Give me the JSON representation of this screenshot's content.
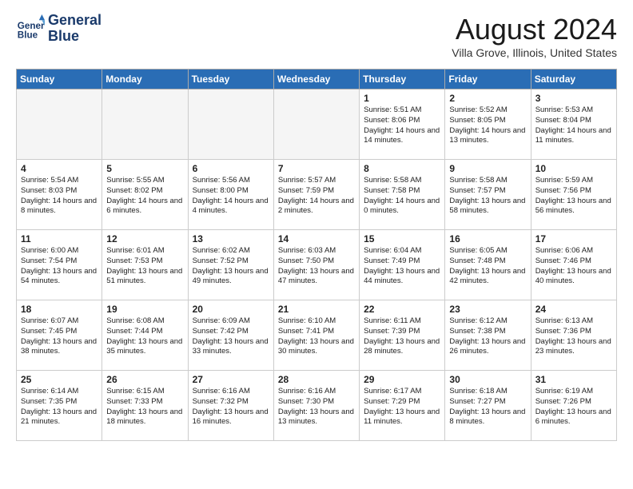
{
  "logo": {
    "line1": "General",
    "line2": "Blue"
  },
  "title": "August 2024",
  "subtitle": "Villa Grove, Illinois, United States",
  "days_of_week": [
    "Sunday",
    "Monday",
    "Tuesday",
    "Wednesday",
    "Thursday",
    "Friday",
    "Saturday"
  ],
  "weeks": [
    [
      {
        "day": "",
        "empty": true
      },
      {
        "day": "",
        "empty": true
      },
      {
        "day": "",
        "empty": true
      },
      {
        "day": "",
        "empty": true
      },
      {
        "day": "1",
        "sunrise": "5:51 AM",
        "sunset": "8:06 PM",
        "daylight": "14 hours and 14 minutes."
      },
      {
        "day": "2",
        "sunrise": "5:52 AM",
        "sunset": "8:05 PM",
        "daylight": "14 hours and 13 minutes."
      },
      {
        "day": "3",
        "sunrise": "5:53 AM",
        "sunset": "8:04 PM",
        "daylight": "14 hours and 11 minutes."
      }
    ],
    [
      {
        "day": "4",
        "sunrise": "5:54 AM",
        "sunset": "8:03 PM",
        "daylight": "14 hours and 8 minutes."
      },
      {
        "day": "5",
        "sunrise": "5:55 AM",
        "sunset": "8:02 PM",
        "daylight": "14 hours and 6 minutes."
      },
      {
        "day": "6",
        "sunrise": "5:56 AM",
        "sunset": "8:00 PM",
        "daylight": "14 hours and 4 minutes."
      },
      {
        "day": "7",
        "sunrise": "5:57 AM",
        "sunset": "7:59 PM",
        "daylight": "14 hours and 2 minutes."
      },
      {
        "day": "8",
        "sunrise": "5:58 AM",
        "sunset": "7:58 PM",
        "daylight": "14 hours and 0 minutes."
      },
      {
        "day": "9",
        "sunrise": "5:58 AM",
        "sunset": "7:57 PM",
        "daylight": "13 hours and 58 minutes."
      },
      {
        "day": "10",
        "sunrise": "5:59 AM",
        "sunset": "7:56 PM",
        "daylight": "13 hours and 56 minutes."
      }
    ],
    [
      {
        "day": "11",
        "sunrise": "6:00 AM",
        "sunset": "7:54 PM",
        "daylight": "13 hours and 54 minutes."
      },
      {
        "day": "12",
        "sunrise": "6:01 AM",
        "sunset": "7:53 PM",
        "daylight": "13 hours and 51 minutes."
      },
      {
        "day": "13",
        "sunrise": "6:02 AM",
        "sunset": "7:52 PM",
        "daylight": "13 hours and 49 minutes."
      },
      {
        "day": "14",
        "sunrise": "6:03 AM",
        "sunset": "7:50 PM",
        "daylight": "13 hours and 47 minutes."
      },
      {
        "day": "15",
        "sunrise": "6:04 AM",
        "sunset": "7:49 PM",
        "daylight": "13 hours and 44 minutes."
      },
      {
        "day": "16",
        "sunrise": "6:05 AM",
        "sunset": "7:48 PM",
        "daylight": "13 hours and 42 minutes."
      },
      {
        "day": "17",
        "sunrise": "6:06 AM",
        "sunset": "7:46 PM",
        "daylight": "13 hours and 40 minutes."
      }
    ],
    [
      {
        "day": "18",
        "sunrise": "6:07 AM",
        "sunset": "7:45 PM",
        "daylight": "13 hours and 38 minutes."
      },
      {
        "day": "19",
        "sunrise": "6:08 AM",
        "sunset": "7:44 PM",
        "daylight": "13 hours and 35 minutes."
      },
      {
        "day": "20",
        "sunrise": "6:09 AM",
        "sunset": "7:42 PM",
        "daylight": "13 hours and 33 minutes."
      },
      {
        "day": "21",
        "sunrise": "6:10 AM",
        "sunset": "7:41 PM",
        "daylight": "13 hours and 30 minutes."
      },
      {
        "day": "22",
        "sunrise": "6:11 AM",
        "sunset": "7:39 PM",
        "daylight": "13 hours and 28 minutes."
      },
      {
        "day": "23",
        "sunrise": "6:12 AM",
        "sunset": "7:38 PM",
        "daylight": "13 hours and 26 minutes."
      },
      {
        "day": "24",
        "sunrise": "6:13 AM",
        "sunset": "7:36 PM",
        "daylight": "13 hours and 23 minutes."
      }
    ],
    [
      {
        "day": "25",
        "sunrise": "6:14 AM",
        "sunset": "7:35 PM",
        "daylight": "13 hours and 21 minutes."
      },
      {
        "day": "26",
        "sunrise": "6:15 AM",
        "sunset": "7:33 PM",
        "daylight": "13 hours and 18 minutes."
      },
      {
        "day": "27",
        "sunrise": "6:16 AM",
        "sunset": "7:32 PM",
        "daylight": "13 hours and 16 minutes."
      },
      {
        "day": "28",
        "sunrise": "6:16 AM",
        "sunset": "7:30 PM",
        "daylight": "13 hours and 13 minutes."
      },
      {
        "day": "29",
        "sunrise": "6:17 AM",
        "sunset": "7:29 PM",
        "daylight": "13 hours and 11 minutes."
      },
      {
        "day": "30",
        "sunrise": "6:18 AM",
        "sunset": "7:27 PM",
        "daylight": "13 hours and 8 minutes."
      },
      {
        "day": "31",
        "sunrise": "6:19 AM",
        "sunset": "7:26 PM",
        "daylight": "13 hours and 6 minutes."
      }
    ]
  ],
  "labels": {
    "sunrise": "Sunrise:",
    "sunset": "Sunset:",
    "daylight": "Daylight:"
  }
}
